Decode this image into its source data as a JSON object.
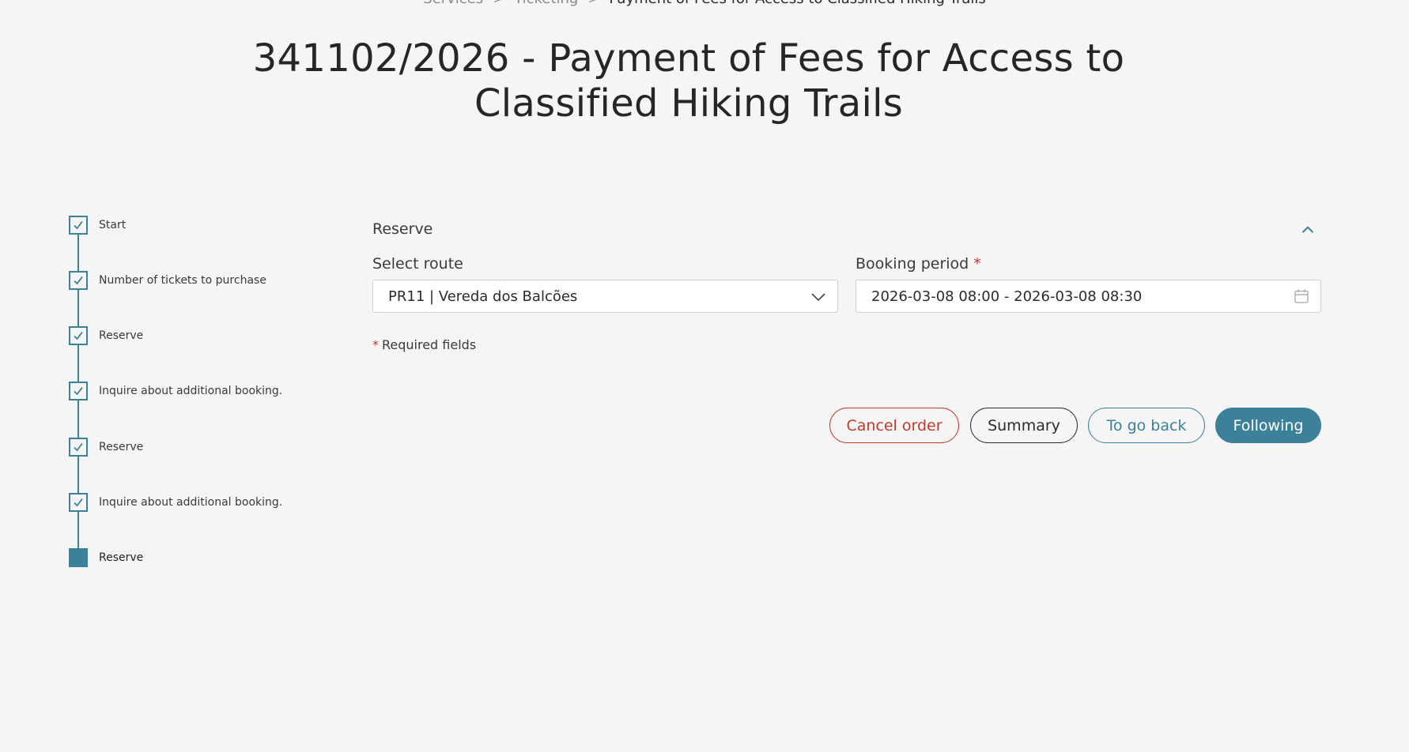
{
  "breadcrumb": {
    "items": [
      "Services",
      "Ticketing",
      "Payment of Fees for Access to Classified Hiking Trails"
    ],
    "separator": ">"
  },
  "page": {
    "title": "341102/2026 - Payment of Fees for Access to Classified Hiking Trails"
  },
  "stepper": {
    "steps": [
      {
        "label": "Start",
        "state": "done"
      },
      {
        "label": "Number of tickets to purchase",
        "state": "done"
      },
      {
        "label": "Reserve",
        "state": "done"
      },
      {
        "label": "Inquire about additional booking.",
        "state": "done"
      },
      {
        "label": "Reserve",
        "state": "done"
      },
      {
        "label": "Inquire about additional booking.",
        "state": "done"
      },
      {
        "label": "Reserve",
        "state": "current"
      }
    ]
  },
  "panel": {
    "title": "Reserve",
    "route": {
      "label": "Select route",
      "value": "PR11 | Vereda dos Balcões"
    },
    "booking_period": {
      "label": "Booking period",
      "required_mark": "*",
      "value": "2026-03-08 08:00 - 2026-03-08 08:30"
    },
    "required_note": {
      "star": "*",
      "text": "Required fields"
    }
  },
  "actions": {
    "cancel": "Cancel order",
    "summary": "Summary",
    "back": "To go back",
    "next": "Following"
  },
  "colors": {
    "accent": "#3c8199",
    "danger": "#c0392b",
    "background": "#f5f5f5"
  }
}
